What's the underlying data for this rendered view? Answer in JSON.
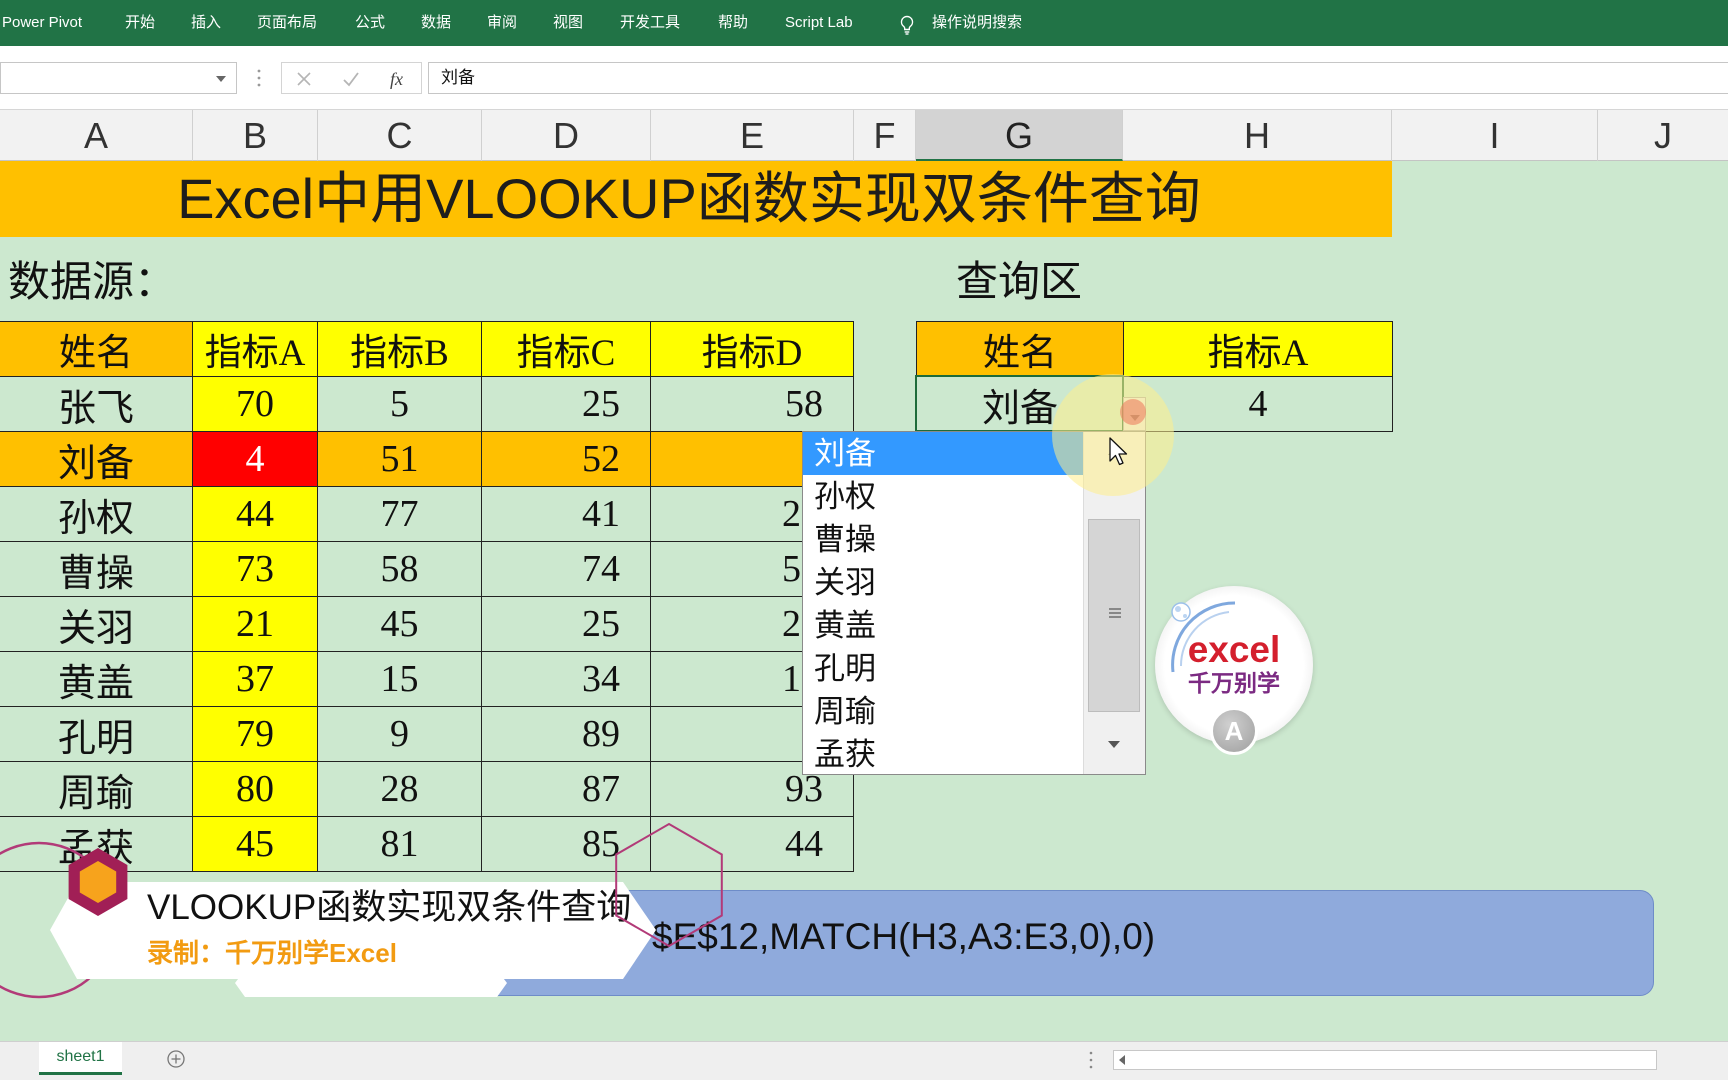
{
  "ribbon": {
    "tabs": [
      "Power Pivot",
      "开始",
      "插入",
      "页面布局",
      "公式",
      "数据",
      "审阅",
      "视图",
      "开发工具",
      "帮助",
      "Script Lab"
    ],
    "search_icon": "lightbulb-icon",
    "search_label": "操作说明搜索"
  },
  "formula_bar": {
    "icons": [
      "name-box-dropdown-icon",
      "cancel-icon",
      "enter-icon"
    ],
    "fx_label": "fx",
    "value": "刘备"
  },
  "columns": [
    "A",
    "B",
    "C",
    "D",
    "E",
    "F",
    "G",
    "H",
    "I",
    "J"
  ],
  "selected_column_index": 6,
  "sheet": {
    "title": "Excel中用VLOOKUP函数实现双条件查询",
    "data_source_label": "数据源：",
    "query_label": "查询区"
  },
  "data_table": {
    "headers": [
      "姓名",
      "指标A",
      "指标B",
      "指标C",
      "指标D"
    ],
    "rows": [
      [
        "张飞",
        "70",
        "5",
        "25",
        "58"
      ],
      [
        "刘备",
        "4",
        "51",
        "52",
        ""
      ],
      [
        "孙权",
        "44",
        "77",
        "41",
        "2"
      ],
      [
        "曹操",
        "73",
        "58",
        "74",
        "5"
      ],
      [
        "关羽",
        "21",
        "45",
        "25",
        "2"
      ],
      [
        "黄盖",
        "37",
        "15",
        "34",
        "1"
      ],
      [
        "孔明",
        "79",
        "9",
        "89",
        ""
      ],
      [
        "周瑜",
        "80",
        "28",
        "87",
        "93"
      ],
      [
        "孟获",
        "45",
        "81",
        "85",
        "44"
      ]
    ],
    "highlighted_row_index": 1
  },
  "query_table": {
    "headers": [
      "姓名",
      "指标A"
    ],
    "name": "刘备",
    "value": "4"
  },
  "dropdown": {
    "items": [
      "刘备",
      "孙权",
      "曹操",
      "关羽",
      "黄盖",
      "孔明",
      "周瑜",
      "孟获"
    ],
    "selected_index": 0
  },
  "logo": {
    "brand": "excel",
    "tagline": "千万别学",
    "badge": "A"
  },
  "caption": {
    "title": "VLOOKUP函数实现双条件查询",
    "subtitle": "录制：千万别学Excel",
    "formula_visible": "$E$12,MATCH(H3,A3:E3,0),0)"
  },
  "sheet_tabs": {
    "tabs": [
      "sheet1"
    ],
    "active_index": 0,
    "add_icon": "add-sheet-icon"
  },
  "colors": {
    "ribbon_green": "#217346",
    "sheet_background": "#cce8cf",
    "orange": "#ffc000",
    "yellow": "#ffff00",
    "red": "#ff0000",
    "dropdown_selected": "#3399ff",
    "formula_overlay": "#8faadc",
    "subtitle_orange": "#f29b11"
  }
}
